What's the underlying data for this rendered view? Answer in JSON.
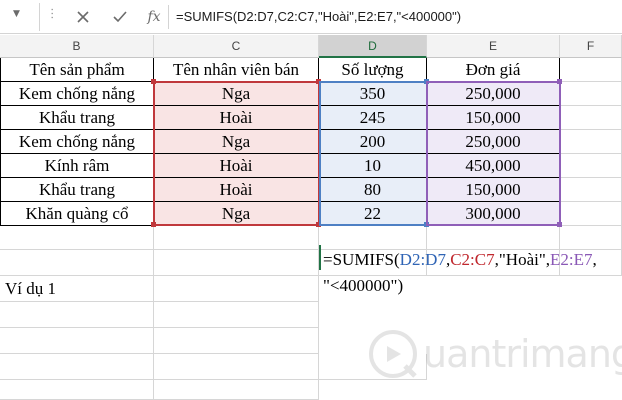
{
  "formula_bar": {
    "cancel_icon": "close-icon",
    "enter_icon": "check-icon",
    "function_icon": "fx",
    "formula": "=SUMIFS(D2:D7,C2:C7,\"Hoài\",E2:E7,\"<400000\")"
  },
  "columns": [
    "B",
    "C",
    "D",
    "E",
    "F"
  ],
  "table": {
    "headers": [
      "Tên sản phẩm",
      "Tên nhân viên bán",
      "Số lượng",
      "Đơn giá"
    ],
    "rows": [
      [
        "Kem chống nắng",
        "Nga",
        "350",
        "250,000"
      ],
      [
        "Khẩu trang",
        "Hoài",
        "245",
        "150,000"
      ],
      [
        "Kem chống nắng",
        "Nga",
        "200",
        "250,000"
      ],
      [
        "Kính râm",
        "Hoài",
        "10",
        "450,000"
      ],
      [
        "Khẩu trang",
        "Hoài",
        "80",
        "150,000"
      ],
      [
        "Khăn quàng cổ",
        "Nga",
        "22",
        "300,000"
      ]
    ]
  },
  "example": {
    "label": "Ví dụ 1",
    "formula_parts": {
      "p1": "=SUMIFS(",
      "r1": "D2:D7",
      "c1": ",",
      "r2": "C2:C7",
      "p2": ",\"Hoài\",",
      "r3": "E2:E7",
      "c2": ",",
      "line2": "\"<400000\")"
    }
  },
  "colors": {
    "range_c": "#c0383c",
    "range_d": "#4e80c4",
    "range_e": "#8f5fb8",
    "selected_header": "#217346"
  },
  "watermark": {
    "text": "uantrimang",
    "icon": "q-logo-icon"
  }
}
